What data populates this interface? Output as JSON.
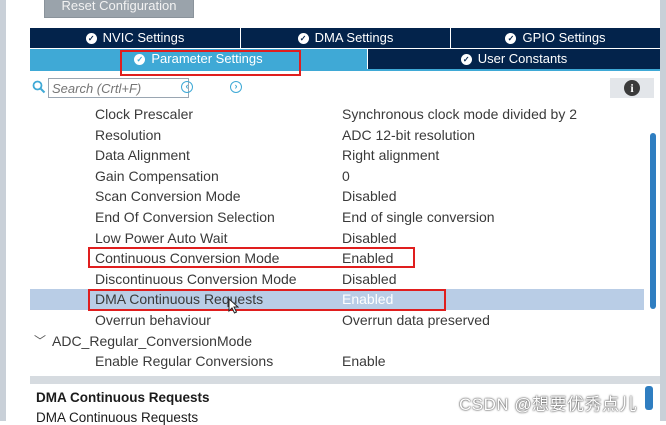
{
  "toolbar": {
    "reset_label": "Reset Configuration"
  },
  "tabs_row1": [
    {
      "label": "NVIC Settings"
    },
    {
      "label": "DMA Settings"
    },
    {
      "label": "GPIO Settings"
    }
  ],
  "tabs_row2": [
    {
      "label": "Parameter Settings",
      "active": true
    },
    {
      "label": "User Constants",
      "active": false
    }
  ],
  "search": {
    "placeholder": "Search (Crtl+F)"
  },
  "params": [
    {
      "name": "Clock Prescaler",
      "value": "Synchronous clock mode divided by 2"
    },
    {
      "name": "Resolution",
      "value": "ADC 12-bit resolution"
    },
    {
      "name": "Data Alignment",
      "value": "Right alignment"
    },
    {
      "name": "Gain Compensation",
      "value": "0"
    },
    {
      "name": "Scan Conversion Mode",
      "value": "Disabled"
    },
    {
      "name": "End Of Conversion Selection",
      "value": "End of single conversion"
    },
    {
      "name": "Low Power Auto Wait",
      "value": "Disabled"
    },
    {
      "name": "Continuous Conversion Mode",
      "value": "Enabled"
    },
    {
      "name": "Discontinuous Conversion Mode",
      "value": "Disabled"
    },
    {
      "name": "DMA Continuous Requests",
      "value": "Enabled"
    },
    {
      "name": "Overrun behaviour",
      "value": "Overrun data preserved"
    }
  ],
  "group": {
    "name": "ADC_Regular_ConversionMode"
  },
  "group_params": [
    {
      "name": "Enable Regular Conversions",
      "value": "Enable"
    }
  ],
  "description": {
    "title": "DMA Continuous Requests",
    "body": "DMA Continuous Requests"
  },
  "watermark": "CSDN @想要优秀点儿",
  "colors": {
    "tab_dark": "#03234b",
    "tab_active": "#3fa9d6",
    "selected_row": "#b9cde6",
    "highlight_box": "#e01e1e"
  }
}
